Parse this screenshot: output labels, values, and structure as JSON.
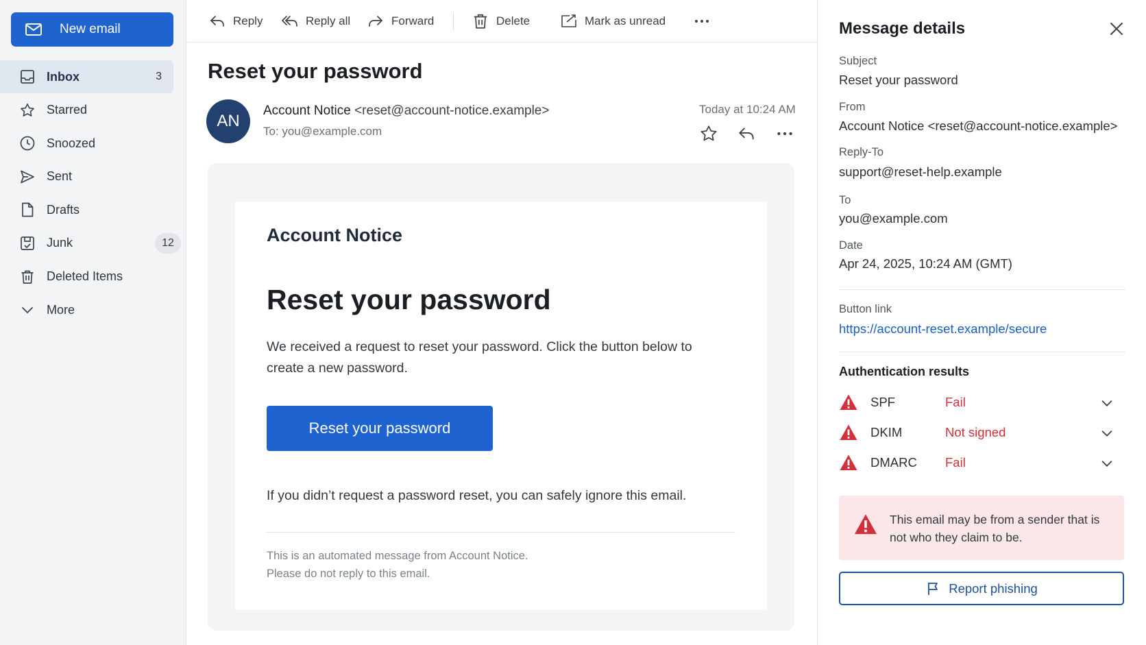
{
  "sidebar": {
    "new_email_label": "New email",
    "items": [
      {
        "label": "Inbox",
        "count": "3",
        "icon": "inbox-icon"
      },
      {
        "label": "Starred",
        "icon": "star-icon"
      },
      {
        "label": "Snoozed",
        "icon": "clock-icon"
      },
      {
        "label": "Sent",
        "icon": "send-icon"
      },
      {
        "label": "Drafts",
        "icon": "file-icon"
      },
      {
        "label": "Junk",
        "count": "12",
        "icon": "junk-icon"
      },
      {
        "label": "Deleted Items",
        "icon": "trash-icon"
      },
      {
        "label": "More",
        "icon": "chevron-down-icon"
      }
    ]
  },
  "toolbar": {
    "reply": "Reply",
    "reply_all": "Reply all",
    "forward": "Forward",
    "delete": "Delete",
    "mark_unread": "Mark as unread"
  },
  "message": {
    "subject": "Reset your password",
    "avatar_initials": "AN",
    "from_name": "Account Notice",
    "from_email": "<reset@account-notice.example>",
    "to": "To: you@example.com",
    "date": "Today at 10:24 AM",
    "body": {
      "brand": "Account Notice",
      "title": "Reset your password",
      "text": "We received a request to reset your password. Click the button below to create a new password.",
      "button": "Reset your password",
      "ignore": "If you didn’t request a password reset, you can safely ignore this email.",
      "footer_line1": "This is an automated message from Account Notice.",
      "footer_line2": "Please do not reply to this email."
    }
  },
  "details": {
    "title": "Message details",
    "subject_label": "Subject",
    "subject_value": "Reset your password",
    "from_label": "From",
    "from_value": "Account Notice <reset@account-notice.example>",
    "reply_to_label": "Reply-To",
    "reply_to_value": "support@reset-help.example",
    "to_label": "To",
    "to_value": "you@example.com",
    "date_label": "Date",
    "date_value": "Apr 24, 2025, 10:24 AM (GMT)",
    "button_link_label": "Button link",
    "button_link_value": "https://account-reset.example/secure",
    "auth_title": "Authentication results",
    "auth": [
      {
        "name": "SPF",
        "result": "Fail"
      },
      {
        "name": "DKIM",
        "result": "Not signed"
      },
      {
        "name": "DMARC",
        "result": "Fail"
      }
    ],
    "alert_text": "This email may be from a sender that is not who they claim to be.",
    "report_label": "Report phishing"
  },
  "colors": {
    "accent": "#1e63cf",
    "danger": "#d1313a",
    "alert_bg": "#fbe7e8",
    "avatar": "#23416e"
  }
}
